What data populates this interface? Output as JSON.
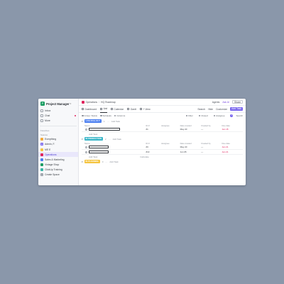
{
  "workspace": {
    "logo_letter": "P",
    "name": "Project Manager"
  },
  "sidebar": {
    "nav": [
      {
        "label": "Inbox",
        "icon": "inbox-icon"
      },
      {
        "label": "Chat",
        "icon": "chat-icon",
        "unread": true
      },
      {
        "label": "More",
        "icon": "more-icon"
      }
    ],
    "favorites_label": "Favorites",
    "spaces_label": "Spaces",
    "spaces": [
      {
        "label": "Everything",
        "color": "#f2a93b",
        "letter": ""
      },
      {
        "label": "Admin, F.",
        "color": "#7b68ee",
        "letter": "A"
      },
      {
        "label": "ME E",
        "color": "#f5c542",
        "letter": ""
      },
      {
        "label": "Operations",
        "color": "#e0245e",
        "letter": "",
        "active": true
      },
      {
        "label": "Sales & Marketing",
        "color": "#4a7ef0",
        "letter": ""
      },
      {
        "label": "Vintage Shop",
        "color": "#1d9e64",
        "letter": ""
      },
      {
        "label": "ClickUp Training",
        "color": "#3ab6a8",
        "letter": ""
      },
      {
        "label": "Create Space",
        "color": "#9aa0a8",
        "letter": "+"
      }
    ]
  },
  "topbar": {
    "breadcrumb_space": "Operations",
    "breadcrumb_list": "HQ Roadmap",
    "agents": "Agents",
    "ask_ai": "Ask AI",
    "share": "Share"
  },
  "views": {
    "tabs": [
      {
        "label": "Dashboard"
      },
      {
        "label": "List",
        "active": true
      },
      {
        "label": "Calendar"
      },
      {
        "label": "Gantt"
      },
      {
        "label": "+ View"
      }
    ],
    "search": "Search",
    "hide": "Hide",
    "customize": "Customize",
    "add_task": "Add Task"
  },
  "filters": {
    "left": [
      "Group: Status",
      "Subtasks",
      "Columns"
    ],
    "right": [
      "Filter",
      "Closed",
      "Assignee"
    ],
    "assignee_count": "1",
    "search": "Search"
  },
  "columns": [
    "Name",
    "ID #",
    "Assignee",
    "Date created",
    "Created by",
    "Due date"
  ],
  "groups": [
    {
      "status": "LIVE ROLLOUT",
      "color": "#4a7ef0",
      "count": "1",
      "add_label": "Add Task",
      "tasks": [
        {
          "id": "#1",
          "date_created": "May 20",
          "created_by": "—",
          "due": "Jan 15"
        }
      ]
    },
    {
      "status": "IN PRODUCTION",
      "color": "#3ab6c8",
      "count": "2",
      "add_label": "Add Task",
      "tasks": [
        {
          "id": "#3",
          "date_created": "May 20",
          "created_by": "—",
          "due": "Jan 21"
        },
        {
          "id": "#13",
          "date_created": "Jun 05",
          "created_by": "—",
          "due": "Jan 21"
        }
      ],
      "calc_label": "Calculate"
    },
    {
      "status": "IN PLANNING",
      "color": "#f5c542",
      "count": "0",
      "add_label": "Add Task"
    }
  ],
  "add_task_row": "Add Task",
  "add_task_caret": "+"
}
